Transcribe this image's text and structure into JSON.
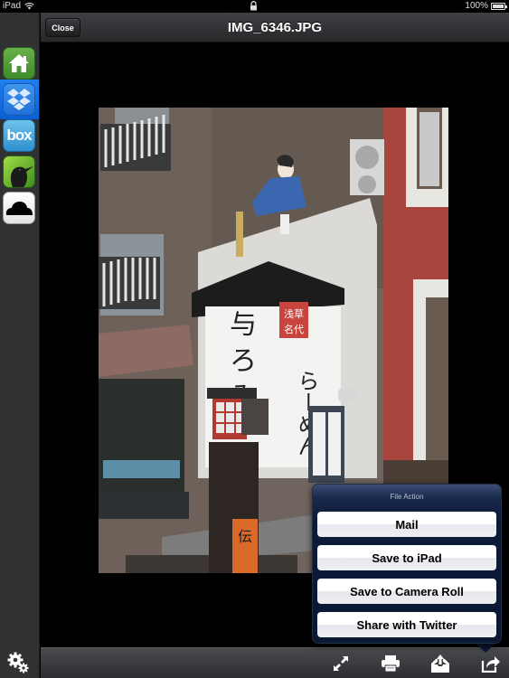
{
  "status_bar": {
    "device": "iPad",
    "battery": "100%"
  },
  "sidebar": {
    "items": [
      {
        "name": "home",
        "icon": "home-icon",
        "selected": false
      },
      {
        "name": "dropbox",
        "icon": "dropbox-icon",
        "selected": true
      },
      {
        "name": "box",
        "icon": "box-icon",
        "label": "box",
        "selected": false
      },
      {
        "name": "bird-service",
        "icon": "bird-icon",
        "selected": false
      },
      {
        "name": "cloud",
        "icon": "cloud-icon",
        "selected": false
      }
    ],
    "settings_icon": "gears-icon"
  },
  "header": {
    "close_label": "Close",
    "title": "IMG_6346.JPG"
  },
  "photo": {
    "description": "Street scene with Japanese ramen shop sign and figure statue on rooftop",
    "sign_text": "らーめん"
  },
  "popover": {
    "title": "File Action",
    "actions": [
      {
        "label": "Mail"
      },
      {
        "label": "Save to iPad"
      },
      {
        "label": "Save to Camera Roll"
      },
      {
        "label": "Share with Twitter"
      }
    ]
  },
  "toolbar": {
    "buttons": [
      {
        "name": "fullscreen",
        "icon": "expand-arrows-icon"
      },
      {
        "name": "print",
        "icon": "printer-icon"
      },
      {
        "name": "upload",
        "icon": "upload-tray-icon"
      },
      {
        "name": "share",
        "icon": "share-arrow-icon"
      }
    ]
  },
  "colors": {
    "popover_bg": "#0c1a38",
    "selected_sidebar": "#1f7ef0",
    "bar_bg": "#2c2d30"
  }
}
